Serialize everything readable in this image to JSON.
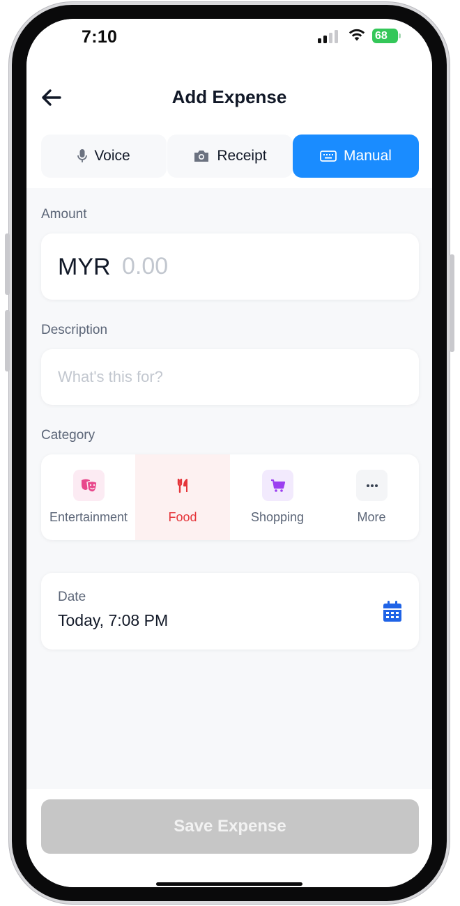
{
  "status_bar": {
    "time": "7:10",
    "battery_level": "68",
    "icons": [
      "cellular-signal-icon",
      "wifi-icon",
      "battery-charging-icon"
    ]
  },
  "header": {
    "title": "Add Expense",
    "back_icon": "arrow-left-icon"
  },
  "mode_tabs": [
    {
      "label": "Voice",
      "icon": "microphone-icon",
      "selected": false
    },
    {
      "label": "Receipt",
      "icon": "camera-icon",
      "selected": false
    },
    {
      "label": "Manual",
      "icon": "keyboard-icon",
      "selected": true
    }
  ],
  "form": {
    "amount": {
      "label": "Amount",
      "currency": "MYR",
      "value": "",
      "placeholder": "0.00"
    },
    "description": {
      "label": "Description",
      "value": "",
      "placeholder": "What's this for?"
    },
    "category": {
      "label": "Category",
      "items": [
        {
          "label": "Entertainment",
          "icon": "theater-masks-icon",
          "color": "#e8488c",
          "selected": false
        },
        {
          "label": "Food",
          "icon": "utensils-icon",
          "color": "#e5353a",
          "selected": true
        },
        {
          "label": "Shopping",
          "icon": "shopping-cart-icon",
          "color": "#9b3ff0",
          "selected": false
        },
        {
          "label": "More",
          "icon": "more-dots-icon",
          "color": "#5b6577",
          "selected": false
        }
      ]
    },
    "date": {
      "label": "Date",
      "value": "Today, 7:08 PM",
      "icon": "calendar-icon"
    }
  },
  "save_button": {
    "label": "Save Expense",
    "enabled": false
  },
  "colors": {
    "accent": "#1a8cff",
    "text_primary": "#111827",
    "text_secondary": "#5b6577",
    "placeholder": "#c2c7cf",
    "food_red": "#e5353a",
    "calendar_blue": "#1f63e6",
    "disabled_button": "#c6c6c6"
  }
}
